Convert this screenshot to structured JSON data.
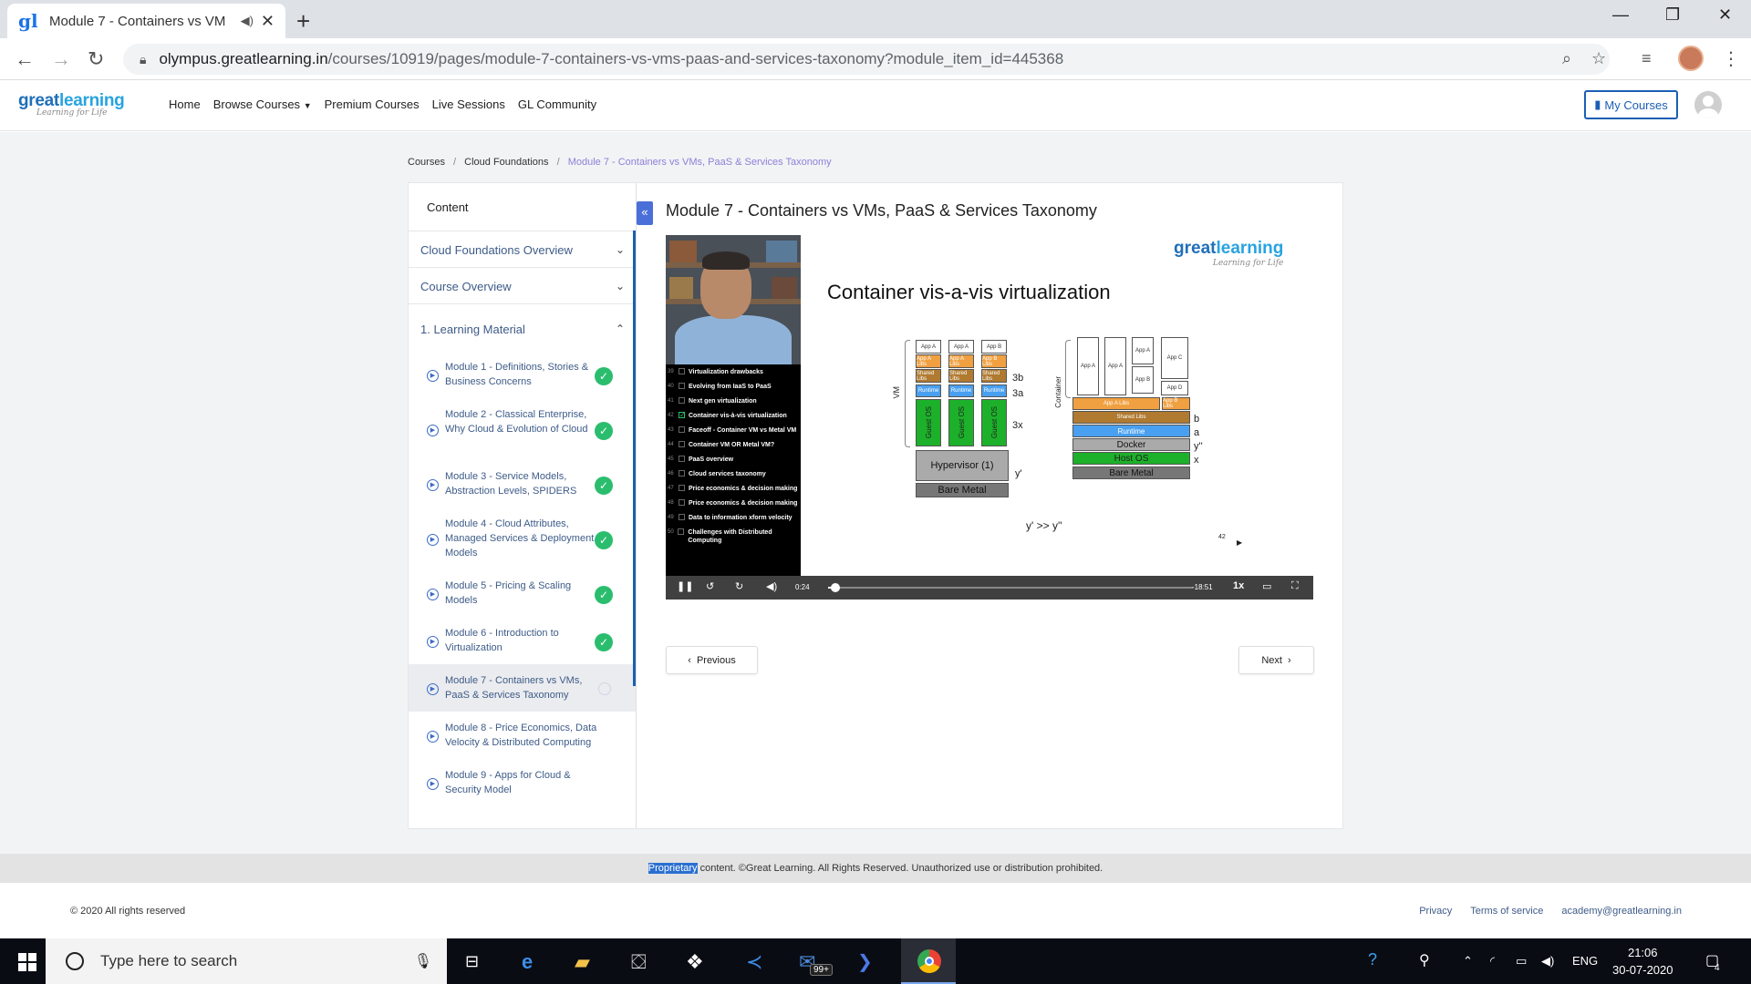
{
  "browser": {
    "tab_title": "Module 7 - Containers vs VM",
    "url_host": "olympus.greatlearning.in",
    "url_path": "/courses/10919/pages/module-7-containers-vs-vms-paas-and-services-taxonomy?module_item_id=445368"
  },
  "site": {
    "logo_text_great": "great",
    "logo_text_learning": "learning",
    "logo_tagline": "Learning for Life",
    "nav": [
      "Home",
      "Browse Courses",
      "Premium Courses",
      "Live Sessions",
      "GL Community"
    ],
    "my_courses": "My Courses"
  },
  "breadcrumb": {
    "items": [
      "Courses",
      "Cloud Foundations"
    ],
    "current": "Module 7 - Containers vs VMs, PaaS & Services Taxonomy"
  },
  "sidebar": {
    "heading": "Content",
    "sections": [
      {
        "label": "Cloud Foundations Overview"
      },
      {
        "label": "Course Overview"
      },
      {
        "label": "1. Learning Material"
      }
    ],
    "modules": [
      {
        "label": "Module 1 - Definitions, Stories & Business Concerns",
        "status": "done"
      },
      {
        "label": "Module 2 - Classical Enterprise, Why Cloud & Evolution of Cloud",
        "status": "done"
      },
      {
        "label": "Module 3 - Service Models, Abstraction Levels, SPIDERS",
        "status": "done"
      },
      {
        "label": "Module 4 - Cloud Attributes, Managed Services & Deployment Models",
        "status": "done"
      },
      {
        "label": "Module 5 - Pricing & Scaling Models",
        "status": "done"
      },
      {
        "label": "Module 6 - Introduction to Virtualization",
        "status": "done"
      },
      {
        "label": "Module 7 - Containers vs VMs, PaaS & Services Taxonomy",
        "status": "current"
      },
      {
        "label": "Module 8 - Price Economics, Data Velocity & Distributed Computing",
        "status": "pending"
      },
      {
        "label": "Module 9 - Apps for Cloud & Security Model",
        "status": "pending"
      }
    ]
  },
  "main": {
    "title": "Module 7 - Containers vs VMs, PaaS & Services Taxonomy",
    "prev_label": "Previous",
    "next_label": "Next"
  },
  "video": {
    "slide_title": "Container vis-a-vis virtualization",
    "slide_number": "42",
    "formula": "y' >> y''",
    "toc": [
      {
        "num": "39",
        "label": "Virtualization drawbacks",
        "checked": false
      },
      {
        "num": "40",
        "label": "Evolving from IaaS to PaaS",
        "checked": false
      },
      {
        "num": "41",
        "label": "Next gen virtualization",
        "checked": false
      },
      {
        "num": "42",
        "label": "Container vis-à-vis virtualization",
        "checked": true
      },
      {
        "num": "43",
        "label": "Faceoff - Container VM vs Metal VM",
        "checked": false
      },
      {
        "num": "44",
        "label": "Container VM OR Metal VM?",
        "checked": false
      },
      {
        "num": "45",
        "label": "PaaS overview",
        "checked": false
      },
      {
        "num": "46",
        "label": "Cloud services taxonomy",
        "checked": false
      },
      {
        "num": "47",
        "label": "Price economics & decision making",
        "checked": false
      },
      {
        "num": "48",
        "label": "Price economics & decision making",
        "checked": false
      },
      {
        "num": "49",
        "label": "Data to information xform velocity",
        "checked": false
      },
      {
        "num": "50",
        "label": "Challenges with Distributed Computing",
        "checked": false
      }
    ],
    "time_elapsed": "0:24",
    "time_remaining": "-18:51",
    "speed": "1x",
    "progress": 0.02,
    "vm_diagram": {
      "side_label": "VM",
      "apps": [
        "App A",
        "App A",
        "App B"
      ],
      "libs": [
        "App A Libs",
        "App A Libs",
        "App B Libs"
      ],
      "shared": [
        "Shared Libs",
        "Shared Libs",
        "Shared Libs"
      ],
      "runtime": [
        "Runtime",
        "Runtime",
        "Runtime"
      ],
      "guest": [
        "Guest OS",
        "Guest OS",
        "Guest OS"
      ],
      "hypervisor": "Hypervisor (1)",
      "bare": "Bare Metal",
      "labels": [
        "3b",
        "3a",
        "3x",
        "y'"
      ]
    },
    "container_diagram": {
      "side_label": "Container",
      "apps": [
        "App A",
        "App A",
        "App A",
        "App C",
        "App B",
        "App D"
      ],
      "libs": [
        "App A Libs",
        "App B Libs"
      ],
      "shared": "Shared Libs",
      "runtime": "Runtime",
      "docker": "Docker",
      "host": "Host OS",
      "bare": "Bare Metal",
      "labels": [
        "b",
        "a",
        "y''",
        "x"
      ]
    }
  },
  "footer": {
    "notice_highlight": "Proprietary",
    "notice_rest": " content. ©Great Learning. All Rights Reserved. Unauthorized use or distribution prohibited.",
    "copyright": "© 2020 All rights reserved",
    "links": [
      "Privacy",
      "Terms of service",
      "academy@greatlearning.in"
    ]
  },
  "taskbar": {
    "search_placeholder": "Type here to search",
    "badge": "99+",
    "lang": "ENG",
    "time": "21:06",
    "date": "30-07-2020",
    "notifications": "4"
  }
}
